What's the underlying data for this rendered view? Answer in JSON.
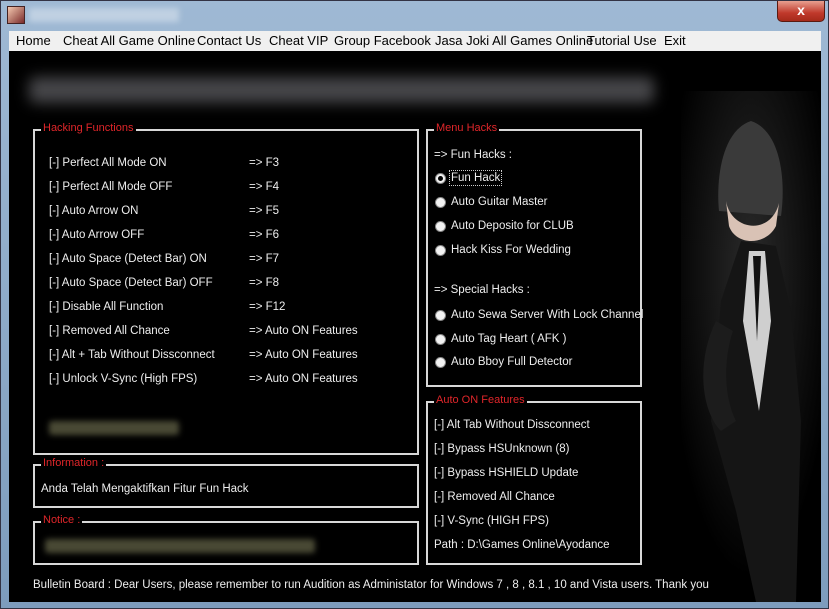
{
  "menu": [
    "Home",
    "Cheat All Game Online",
    "Contact Us",
    "Cheat VIP",
    "Group Facebook",
    "Jasa Joki All Games Online",
    "Tutorial Use",
    "Exit"
  ],
  "window": {
    "close_label": "x"
  },
  "hacking": {
    "title": "Hacking Functions",
    "rows": [
      {
        "label": "[-] Perfect All Mode ON",
        "key": "=> F3"
      },
      {
        "label": "[-] Perfect All Mode OFF",
        "key": "=> F4"
      },
      {
        "label": "[-] Auto Arrow ON",
        "key": "=> F5"
      },
      {
        "label": "[-] Auto Arrow OFF",
        "key": "=> F6"
      },
      {
        "label": "[-] Auto Space (Detect Bar) ON",
        "key": "=> F7"
      },
      {
        "label": "[-] Auto Space (Detect Bar) OFF",
        "key": "=> F8"
      },
      {
        "label": "[-] Disable All Function",
        "key": "=> F12"
      },
      {
        "label": "[-] Removed All Chance",
        "key": "=> Auto ON Features"
      },
      {
        "label": "[-] Alt + Tab Without Dissconnect",
        "key": "=> Auto ON Features"
      },
      {
        "label": "[-] Unlock V-Sync (High FPS)",
        "key": "=> Auto ON Features"
      }
    ]
  },
  "information": {
    "title": "Information :",
    "text": "Anda Telah Mengaktifkan Fitur Fun Hack"
  },
  "notice": {
    "title": "Notice :"
  },
  "menu_hacks": {
    "title": "Menu Hacks",
    "fun_header": "=> Fun Hacks :",
    "fun": [
      "Fun Hack",
      "Auto Guitar Master",
      "Auto Deposito for CLUB",
      "Hack Kiss For Wedding"
    ],
    "selected": "Fun Hack",
    "special_header": "=> Special Hacks :",
    "special": [
      "Auto Sewa Server With Lock Channel",
      "Auto Tag Heart ( AFK )",
      "Auto Bboy Full Detector"
    ]
  },
  "auto_on": {
    "title": "Auto ON Features",
    "items": [
      "[-] Alt Tab Without Dissconnect",
      "[-] Bypass HSUnknown (8)",
      "[-] Bypass HSHIELD Update",
      "[-] Removed All Chance",
      "[-] V-Sync (HIGH FPS)"
    ],
    "path": "Path :  D:\\Games Online\\Ayodance"
  },
  "bulletin": "Bulletin Board : Dear Users, please remember to run Audition as Administator for Windows 7 , 8 , 8.1 , 10 and Vista users. Thank you",
  "colors": {
    "legend": "#e0262a",
    "border": "#d8d8d8",
    "background": "#000000"
  }
}
